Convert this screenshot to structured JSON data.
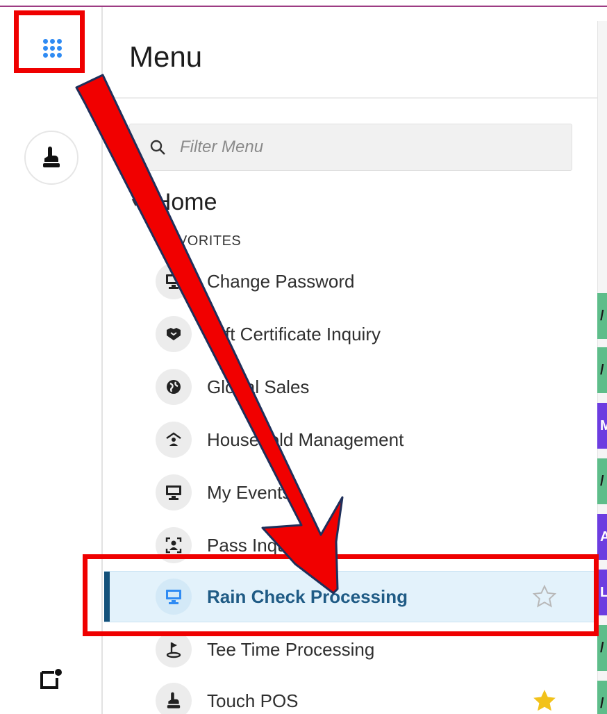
{
  "menu": {
    "title": "Menu",
    "filter_placeholder": "Filter Menu",
    "home_label": "Home",
    "favorites_label": "FAVORITES",
    "items": [
      {
        "label": "Change Password",
        "icon": "monitor-icon",
        "starred": false
      },
      {
        "label": "Gift Certificate Inquiry",
        "icon": "handshake-icon",
        "starred": false
      },
      {
        "label": "Global Sales",
        "icon": "globe-icon",
        "starred": false
      },
      {
        "label": "Household Management",
        "icon": "household-icon",
        "starred": false
      },
      {
        "label": "My Events",
        "icon": "monitor-icon",
        "starred": false
      },
      {
        "label": "Pass Inquiry",
        "icon": "face-scan-icon",
        "starred": false
      },
      {
        "label": "Rain Check Processing",
        "icon": "monitor-icon",
        "starred": false,
        "active": true
      },
      {
        "label": "Tee Time Processing",
        "icon": "golf-icon",
        "starred": false
      },
      {
        "label": "Touch POS",
        "icon": "touch-icon",
        "starred": true
      }
    ]
  },
  "colors": {
    "accent_blue": "#2f8bf3",
    "active_bar": "#14517a",
    "active_bg": "#e3f2fb",
    "annotation_red": "#ef0000",
    "star_gold": "#f2c21b"
  },
  "right_panel": {
    "tabs": [
      "/",
      "/",
      "M",
      "/",
      "A",
      "L",
      "/",
      "/"
    ]
  }
}
